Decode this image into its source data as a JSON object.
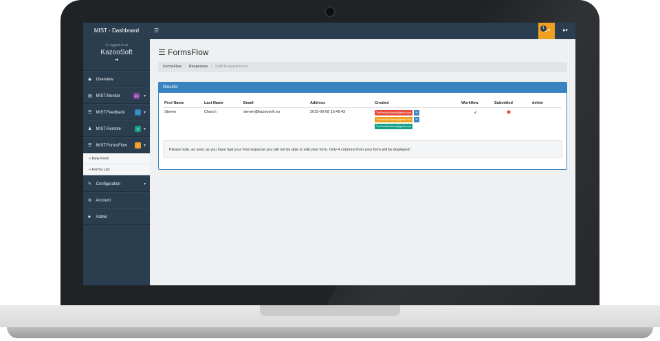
{
  "topbar": {
    "brand": "MIST - Dashboard",
    "menu_icon": "bars-icon",
    "notification_count": "1",
    "user_icon": "user-icon"
  },
  "sidebar": {
    "logged_in_label": "Logged in as",
    "user_name": "KazooSoft",
    "items": [
      {
        "label": "Overview",
        "icon": "dashboard-icon"
      },
      {
        "label": "MIST.Monitor",
        "badge": "24",
        "badge_color": "#8e44ad"
      },
      {
        "label": "MIST.Feedback",
        "badge": "1",
        "badge_color": "#2e86c1"
      },
      {
        "label": "MIST.Remote",
        "badge": "0",
        "badge_color": "#16a085"
      },
      {
        "label": "MIST.FormsFlow",
        "badge": "1",
        "badge_color": "#f0a020"
      }
    ],
    "sub_items": [
      {
        "label": "New Form"
      },
      {
        "label": "Forms List"
      }
    ],
    "lower_items": [
      {
        "label": "Configuration"
      },
      {
        "label": "Account"
      },
      {
        "label": "Admin"
      }
    ]
  },
  "main": {
    "title": "FormsFlow",
    "breadcrumb": [
      "FormsFlow",
      "Responses",
      "Staff Request Form"
    ],
    "panel_title": "Results!",
    "columns": [
      "First Name",
      "Last Name",
      "Email",
      "Address",
      "Created",
      "Workflow",
      "Submitted",
      "delete"
    ],
    "row": {
      "first_name": "Steven",
      "last_name": "Church",
      "email": "steven@kazoosoft.eu",
      "address": "2015-06-08 15:49:43",
      "tags": [
        {
          "text": "TheEmailAddress@gmail.com",
          "color": "#e74c3c"
        },
        {
          "text": "TheEmailAddress@gmail.com",
          "color": "#f0a020"
        },
        {
          "text": "TheEmailAddress@gmail.com",
          "color": "#16a085"
        }
      ]
    },
    "note": "Please note, as soon as you have had your first response you will not be able to edit your form. Only 4 columns from your form will be displayed!"
  }
}
